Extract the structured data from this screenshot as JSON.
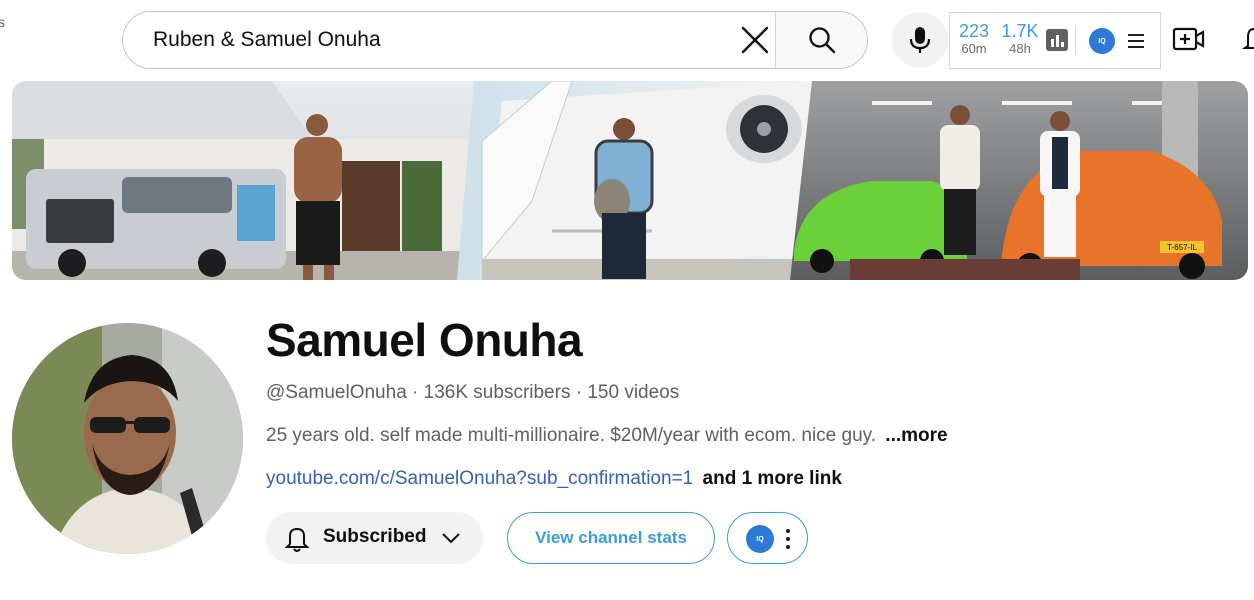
{
  "top_edge_glyph": "s",
  "search": {
    "value": "Ruben & Samuel Onuha"
  },
  "extension_widget": {
    "stat1_value": "223",
    "stat1_label": "60m",
    "stat2_value": "1.7K",
    "stat2_label": "48h",
    "logo_text": "IQ"
  },
  "channel": {
    "name": "Samuel Onuha",
    "handle": "@SamuelOnuha",
    "subscribers": "136K subscribers",
    "videos": "150 videos",
    "separator": " · ",
    "description": "25 years old. self made multi-millionaire. $20M/year with ecom. nice guy.",
    "more_label": "...more",
    "link_text": "youtube.com/c/SamuelOnuha?sub_confirmation=1",
    "more_links_label": "and 1 more link"
  },
  "actions": {
    "subscribed_label": "Subscribed",
    "view_stats_label": "View channel stats",
    "ext_logo_text": "IQ"
  },
  "banner": {
    "plate_text": "T-657-IL"
  },
  "colors": {
    "accent_blue": "#3c9ce0",
    "link_blue": "#3561b5",
    "extension_logo": "#2f79d6",
    "button_grey": "#f2f2f2"
  },
  "icons": [
    "close-icon",
    "search-icon",
    "microphone-icon",
    "bar-chart-icon",
    "menu-icon",
    "create-video-icon",
    "bell-icon",
    "chevron-down-icon",
    "more-vertical-icon"
  ]
}
